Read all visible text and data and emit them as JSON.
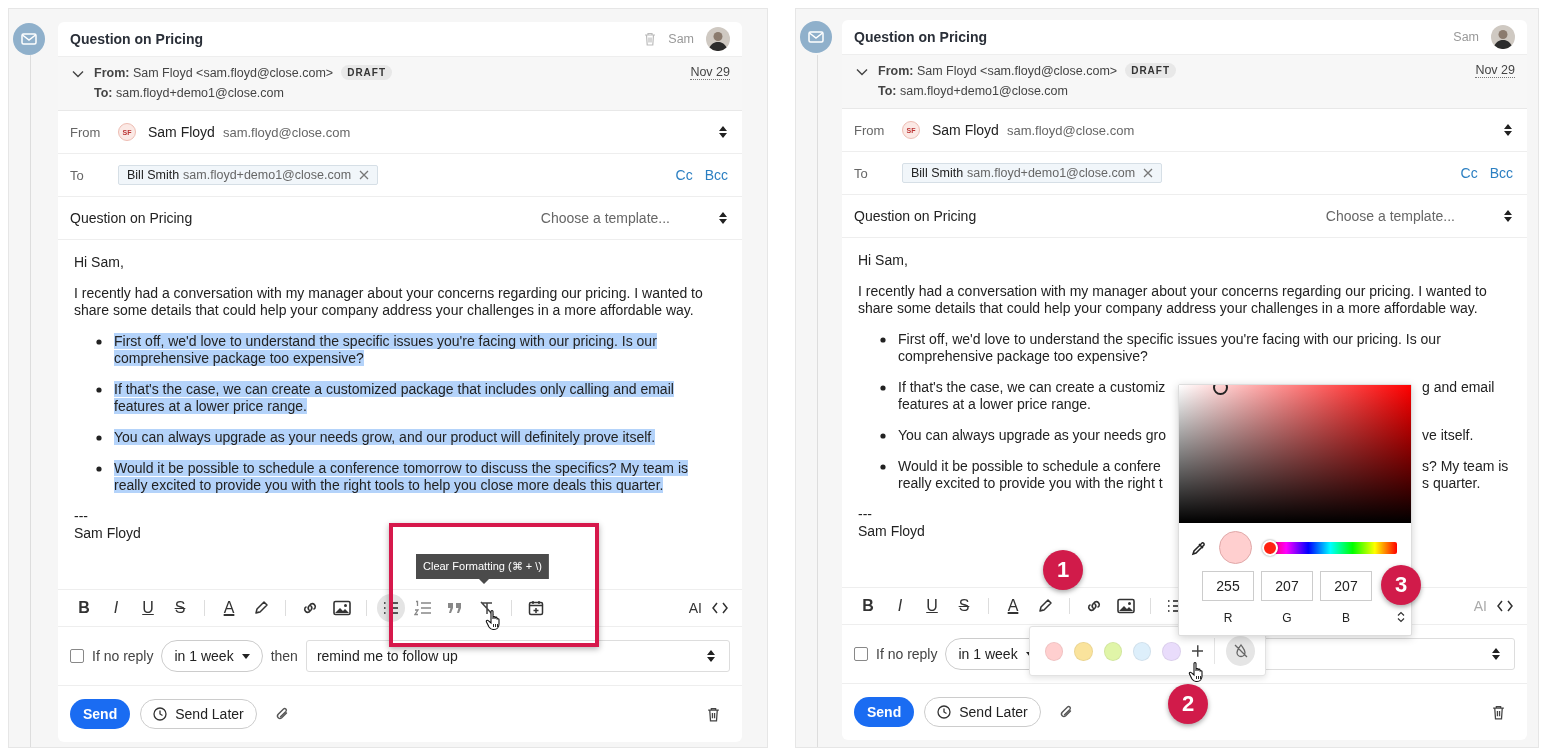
{
  "panels": [
    {
      "title": "Question on Pricing",
      "show_delete": true,
      "owner": "Sam",
      "meta": {
        "from": "**From:** Sam Floyd <sam.floyd@close.com>",
        "badge": "DRAFT",
        "date": "Nov 29",
        "to": "**To:** sam.floyd+demo1@close.com"
      },
      "from_field": {
        "label": "From",
        "initials": "SF",
        "name": "Sam Floyd",
        "email": "sam.floyd@close.com"
      },
      "to_field": {
        "label": "To",
        "recipients": [
          {
            "name": "Bill Smith",
            "email": "sam.floyd+demo1@close.com"
          }
        ],
        "cc": "Cc",
        "bcc": "Bcc"
      },
      "subject": {
        "value": "Question on Pricing",
        "template_placeholder": "Choose a template..."
      },
      "body": {
        "greeting": "Hi Sam,",
        "paragraph": "I recently had a conversation with my manager about your concerns regarding our pricing. I wanted to share some details that could help your company address your challenges in a more affordable way.",
        "bullets": [
          {
            "highlighted": true,
            "lines": [
              [
                "First off, we'd love to understand the specific issues you're facing with our pricing. Is our"
              ],
              [
                "comprehensive package too expensive?"
              ]
            ]
          },
          {
            "highlighted": true,
            "lines": [
              [
                "If that's the case, we can create a customized package that includes only calling and email"
              ],
              [
                "features at a lower price range."
              ]
            ]
          },
          {
            "highlighted": true,
            "lines": [
              [
                "You can always upgrade as your needs grow, and our product will definitely prove itself."
              ]
            ]
          },
          {
            "highlighted": true,
            "lines": [
              [
                "Would it be possible to schedule a conference tomorrow to discuss the specifics? My team is"
              ],
              [
                "really excited to provide you with the right tools to help you close more deals this quarter."
              ]
            ]
          }
        ],
        "signature": [
          "---",
          "Sam Floyd"
        ]
      },
      "toolbar": {
        "buttons": [
          {
            "kind": "bold",
            "label": "B",
            "active": false
          },
          {
            "kind": "italic",
            "label": "I",
            "active": false
          },
          {
            "kind": "underline",
            "label": "U",
            "active": false
          },
          {
            "kind": "strike",
            "label": "S",
            "active": false
          },
          {
            "kind": "separator"
          },
          {
            "kind": "text-color",
            "label": "A",
            "active": false
          },
          {
            "kind": "highlighter",
            "active": false
          },
          {
            "kind": "separator"
          },
          {
            "kind": "link",
            "active": false
          },
          {
            "kind": "image",
            "active": false
          },
          {
            "kind": "separator"
          },
          {
            "kind": "bullet-list",
            "active": true
          },
          {
            "kind": "numbered-list",
            "active": false
          },
          {
            "kind": "quote",
            "active": false
          },
          {
            "kind": "clear-format",
            "active": false
          },
          {
            "kind": "separator"
          },
          {
            "kind": "calendar",
            "active": false
          }
        ],
        "ai": {
          "label": "AI",
          "disabled": false
        }
      },
      "followup": {
        "checked": false,
        "label": "If no reply",
        "delay": "in 1 week",
        "then": "then",
        "action": "remind me to follow up"
      },
      "footer": {
        "send": "Send",
        "send_later": "Send Later"
      },
      "overlays": [
        {
          "kind": "highlight_box"
        },
        {
          "kind": "tooltip",
          "text": "Clear Formatting (⌘ + \\)"
        },
        {
          "kind": "cursor"
        }
      ]
    },
    {
      "title": "Question on Pricing",
      "show_delete": false,
      "owner": "Sam",
      "meta": {
        "from": "**From:** Sam Floyd <sam.floyd@close.com>",
        "badge": "DRAFT",
        "date": "Nov 29",
        "to": "**To:** sam.floyd+demo1@close.com"
      },
      "from_field": {
        "label": "From",
        "initials": "SF",
        "name": "Sam Floyd",
        "email": "sam.floyd@close.com"
      },
      "to_field": {
        "label": "To",
        "recipients": [
          {
            "name": "Bill Smith",
            "email": "sam.floyd+demo1@close.com"
          }
        ],
        "cc": "Cc",
        "bcc": "Bcc"
      },
      "subject": {
        "value": "Question on Pricing",
        "template_placeholder": "Choose a template..."
      },
      "body": {
        "greeting": "Hi Sam,",
        "paragraph": "I recently had a conversation with my manager about your concerns regarding our pricing. I wanted to share some details that could help your company address your challenges in a more affordable way.",
        "bullets": [
          {
            "highlighted": false,
            "lines": [
              [
                "First off, we'd love to understand the specific issues you're facing with our pricing. Is our"
              ],
              [
                "comprehensive package too expensive?"
              ]
            ]
          },
          {
            "highlighted": false,
            "lines": [
              [
                "If that's the case, we can create a customiz",
                "g and email"
              ],
              [
                "features at a lower price range."
              ]
            ]
          },
          {
            "highlighted": false,
            "lines": [
              [
                "You can always upgrade as your needs gro",
                "ve itself."
              ]
            ]
          },
          {
            "highlighted": false,
            "lines": [
              [
                "Would it be possible to schedule a confere",
                "s? My team is"
              ],
              [
                "really excited to provide you with the right t",
                "s quarter."
              ]
            ]
          }
        ],
        "signature": [
          "---",
          "Sam Floyd"
        ]
      },
      "toolbar": {
        "buttons": [
          {
            "kind": "bold",
            "label": "B",
            "active": false
          },
          {
            "kind": "italic",
            "label": "I",
            "active": false
          },
          {
            "kind": "underline",
            "label": "U",
            "active": false
          },
          {
            "kind": "strike",
            "label": "S",
            "active": false
          },
          {
            "kind": "separator"
          },
          {
            "kind": "text-color",
            "label": "A",
            "active": false
          },
          {
            "kind": "highlighter",
            "active": false
          },
          {
            "kind": "separator"
          },
          {
            "kind": "link",
            "active": false
          },
          {
            "kind": "image",
            "active": false
          },
          {
            "kind": "separator"
          },
          {
            "kind": "bullet-list",
            "active": false
          }
        ],
        "ai": {
          "label": "AI",
          "disabled": true
        }
      },
      "followup": {
        "checked": false,
        "label": "If no reply",
        "delay": "in 1 week"
      },
      "footer": {
        "send": "Send",
        "send_later": "Send Later"
      },
      "overlays": [
        {
          "kind": "color_palette",
          "swatches": [
            {
              "color": "#ffcfcf"
            },
            {
              "color": "#fae39c"
            },
            {
              "color": "#e0f5a8"
            },
            {
              "color": "#ddeffb"
            },
            {
              "color": "#e9dcfb"
            }
          ]
        },
        {
          "kind": "color_picker",
          "hue": {
            "level": 0
          },
          "channels": [
            {
              "value": "255",
              "label": "R"
            },
            {
              "value": "207",
              "label": "G"
            },
            {
              "value": "207",
              "label": "B"
            }
          ]
        },
        {
          "kind": "step",
          "text": "1"
        },
        {
          "kind": "step",
          "text": "2"
        },
        {
          "kind": "step",
          "text": "3"
        },
        {
          "kind": "cursor"
        }
      ]
    }
  ]
}
